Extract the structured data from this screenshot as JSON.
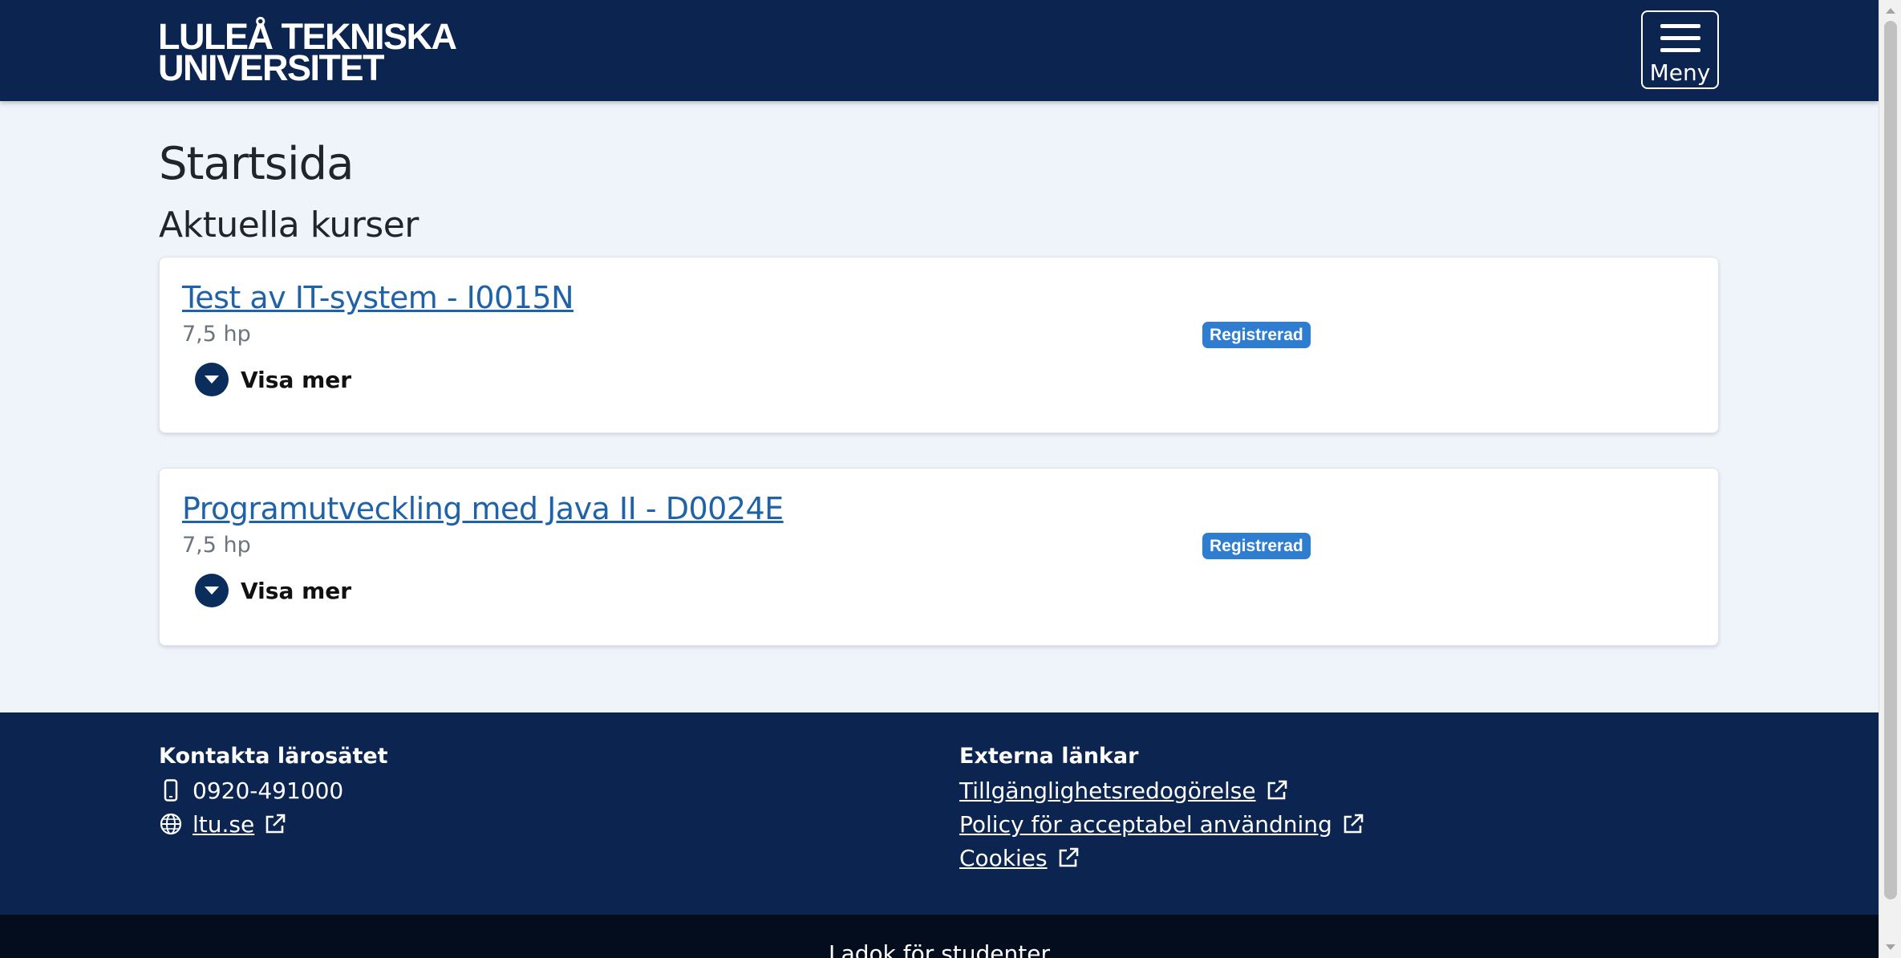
{
  "header": {
    "logo_line1": "LULEÅ TEKNISKA",
    "logo_line2": "UNIVERSITET",
    "menu_label": "Meny",
    "background_color": "#0b2450"
  },
  "main": {
    "page_title": "Startsida",
    "section_title": "Aktuella kurser",
    "courses": [
      {
        "title": "Test av IT-system - I0015N",
        "credits": "7,5 hp",
        "status": "Registrerad",
        "toggle_label": "Visa mer",
        "toggle_icon": "chevron-down-icon"
      },
      {
        "title": "Programutveckling med Java II - D0024E",
        "credits": "7,5 hp",
        "status": "Registrerad",
        "toggle_label": "Visa mer",
        "toggle_icon": "chevron-down-icon"
      }
    ],
    "link_color": "#1f62a7",
    "badge_color": "#2e7dd0"
  },
  "footer": {
    "contact": {
      "heading": "Kontakta lärosätet",
      "phone": "0920-491000",
      "phone_icon": "phone-icon",
      "website": "ltu.se",
      "website_icon": "globe-icon"
    },
    "external": {
      "heading": "Externa länkar",
      "links": [
        "Tillgänglighetsredogörelse",
        "Policy för acceptabel användning",
        "Cookies"
      ],
      "link_icon": "external-link-icon"
    },
    "bottom_text": "Ladok för studenter"
  }
}
